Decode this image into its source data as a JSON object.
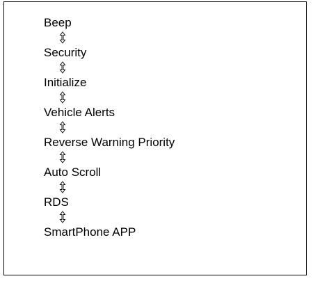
{
  "menu_sequence": {
    "items": [
      "Beep",
      "Security",
      "Initialize",
      "Vehicle Alerts",
      "Reverse Warning Priority",
      "Auto Scroll",
      "RDS",
      "SmartPhone APP"
    ],
    "connector_icon": "up-down-arrow-icon"
  }
}
